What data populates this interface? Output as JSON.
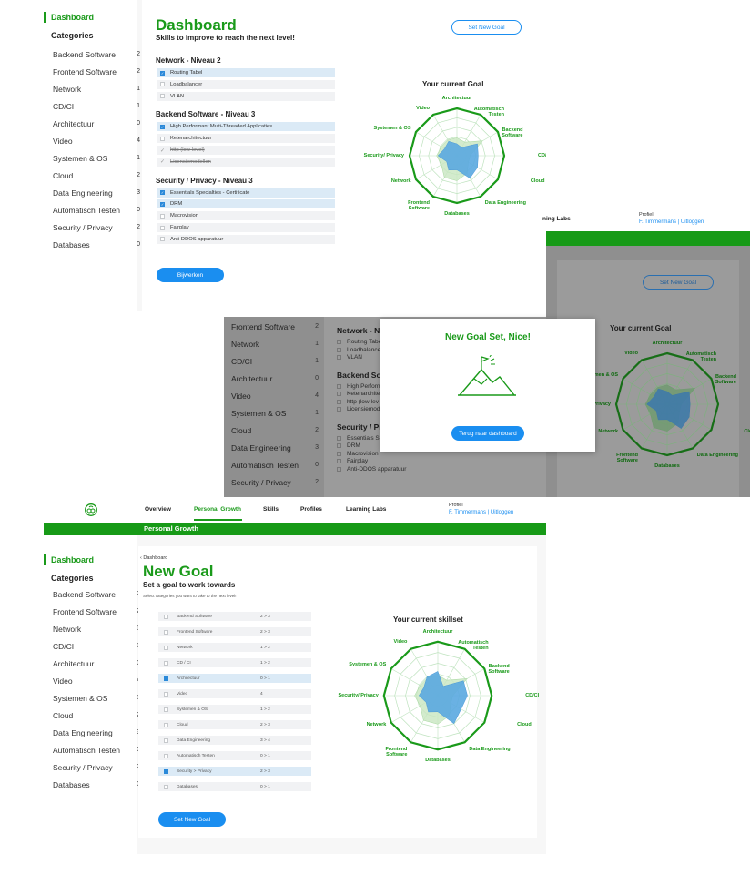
{
  "categories": [
    {
      "name": "Backend Software",
      "count": "2"
    },
    {
      "name": "Frontend Software",
      "count": "2"
    },
    {
      "name": "Network",
      "count": "1"
    },
    {
      "name": "CD/CI",
      "count": "1"
    },
    {
      "name": "Architectuur",
      "count": "0"
    },
    {
      "name": "Video",
      "count": "4"
    },
    {
      "name": "Systemen & OS",
      "count": "1"
    },
    {
      "name": "Cloud",
      "count": "2"
    },
    {
      "name": "Data Engineering",
      "count": "3"
    },
    {
      "name": "Automatisch Testen",
      "count": "0"
    },
    {
      "name": "Security / Privacy",
      "count": "2"
    },
    {
      "name": "Databases",
      "count": "0"
    }
  ],
  "sidebar": {
    "title": "Dashboard",
    "categories_heading": "Categories"
  },
  "dashboard": {
    "title": "Dashboard",
    "subtitle": "Skills to improve to reach the next level!",
    "set_goal_label": "Set New Goal",
    "update_label": "Bijwerken",
    "sections": [
      {
        "heading": "Network - Niveau 2",
        "items": [
          {
            "label": "Routing Tabel",
            "state": "checked"
          },
          {
            "label": "Loadbalancer",
            "state": "open"
          },
          {
            "label": "VLAN",
            "state": "open"
          }
        ]
      },
      {
        "heading": "Backend  Software - Niveau 3",
        "items": [
          {
            "label": "High Performant Multi-Threaded Applicaties",
            "state": "checked"
          },
          {
            "label": "Ketenarchitectuur",
            "state": "open"
          },
          {
            "label": "http (low-level)",
            "state": "done"
          },
          {
            "label": "Licensiemodellen",
            "state": "done"
          }
        ]
      },
      {
        "heading": "Security / Privacy - Niveau 3",
        "items": [
          {
            "label": "Essentials Specialties - Certificate",
            "state": "checked"
          },
          {
            "label": "DRM",
            "state": "checked"
          },
          {
            "label": "Macrovision",
            "state": "open"
          },
          {
            "label": "Fairplay",
            "state": "open"
          },
          {
            "label": "Anti-DDOS apparatuur",
            "state": "open"
          }
        ]
      }
    ],
    "radar_title": "Your current Goal"
  },
  "radar_labels": {
    "architectuur": "Architectuur",
    "automatisch": "Automatisch Testen",
    "backend": "Backend Software",
    "cdci": "CD/CI",
    "cloud": "Cloud",
    "data": "Data Engineering",
    "databases": "Databases",
    "frontend": "Frontend Software",
    "network": "Network",
    "security": "Security/ Privacy",
    "systemen": "Systemen & OS",
    "video": "Video"
  },
  "modal": {
    "title": "New Goal Set, Nice!",
    "button_label": "Terug naar dashboard",
    "partial_network": "Network - Ni",
    "partial_backend": "Backend Sof",
    "partial_security": "Security / Pr",
    "partial_items_net": [
      "Routing Tabe",
      "Loadbalance",
      "VLAN"
    ],
    "partial_items_back": [
      "High Perforn",
      "Ketenarchite",
      "http (low-lev",
      "Licensiemod"
    ],
    "partial_items_sec": [
      "Essentials Sp",
      "DRM",
      "Macrovision",
      "Fairplay",
      "Anti-DDOS apparatuur"
    ],
    "header_fragment": "ning Labs",
    "profile_label": "Profiel",
    "profile_user": "F. Timmermans | Uitloggen",
    "set_goal_label": "Set New Goal",
    "radar_title": "Your current Goal",
    "partial_label_frontend": "ontend ftware",
    "partial_label_security": "n"
  },
  "nav": {
    "items": [
      "Overview",
      "Personal Growth",
      "Skills",
      "Profiles",
      "Learning Labs"
    ],
    "profile_label": "Profiel",
    "profile_user": "F. Timmermans | Uitloggen",
    "banner": "Personal Growth"
  },
  "newgoal": {
    "breadcrumb": "‹ Dashboard",
    "title": "New Goal",
    "subtitle": "Set a goal to work towards",
    "hint": "Select categories you want to take to the next level!",
    "rows": [
      {
        "label": "Backend Software",
        "level": "2 > 3",
        "checked": false
      },
      {
        "label": "Frontend Software",
        "level": "2 > 3",
        "checked": false
      },
      {
        "label": "Network",
        "level": "1 > 2",
        "checked": false
      },
      {
        "label": "CD / CI",
        "level": "1 > 2",
        "checked": false
      },
      {
        "label": "Architectuur",
        "level": "0 > 1",
        "checked": true
      },
      {
        "label": "Video",
        "level": "4",
        "checked": false
      },
      {
        "label": "Systemen & OS",
        "level": "1 > 2",
        "checked": false
      },
      {
        "label": "Cloud",
        "level": "2 > 3",
        "checked": false
      },
      {
        "label": "Data Engineering",
        "level": "3 > 4",
        "checked": false
      },
      {
        "label": "Automatisch Testen",
        "level": "0 > 1",
        "checked": false
      },
      {
        "label": "Security > Privacy",
        "level": "2 > 3",
        "checked": true
      },
      {
        "label": "Databases",
        "level": "0 > 1",
        "checked": false
      }
    ],
    "button_label": "Set New Goal",
    "radar_title": "Your current skillset"
  },
  "colors": {
    "brand_green": "#1a9a1a",
    "accent_blue": "#1a8ef0",
    "radar_fill": "#5aa8e0"
  }
}
